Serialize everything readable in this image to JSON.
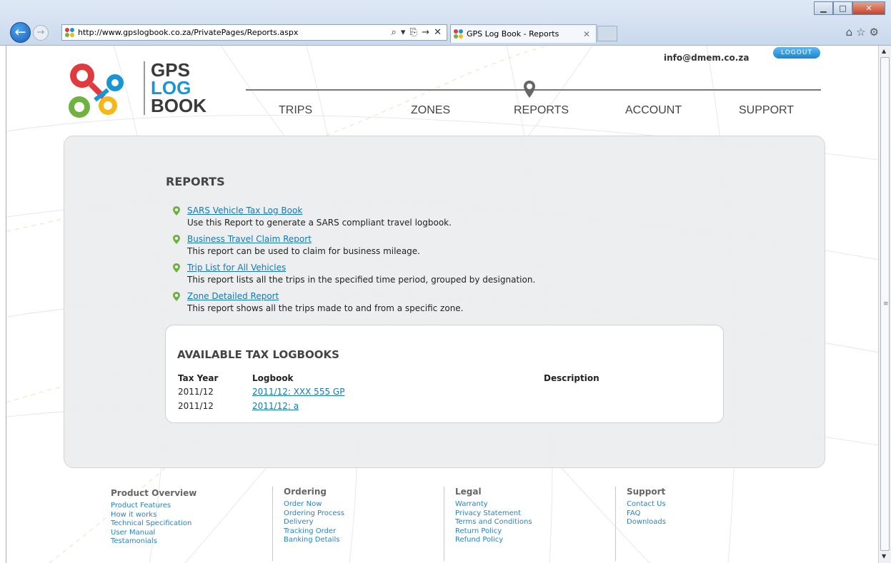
{
  "browser": {
    "url": "http://www.gpslogbook.co.za/PrivatePages/Reports.aspx",
    "address_tools": "⌕ ▾ ⎘ → ✕",
    "tab_title": "GPS Log Book - Reports",
    "tab_close": "✕",
    "back": "←",
    "forward": "→",
    "window_buttons": {
      "minimize": "▁",
      "maximize": "□",
      "close": "✕"
    },
    "toolbar_icons": "⌂☆⚙"
  },
  "header": {
    "logo": {
      "line1": "GPS",
      "line2": "LOG",
      "line3": "BOOK"
    },
    "user_email": "info@dmem.co.za",
    "logout_label": "LOGOUT",
    "nav": [
      {
        "label": "TRIPS"
      },
      {
        "label": "ZONES"
      },
      {
        "label": "REPORTS",
        "active": true
      },
      {
        "label": "ACCOUNT"
      },
      {
        "label": "SUPPORT"
      }
    ]
  },
  "reports": {
    "title": "REPORTS",
    "items": [
      {
        "link": "SARS Vehicle Tax Log Book",
        "desc": "Use this Report to generate a SARS compliant travel logbook."
      },
      {
        "link": "Business Travel Claim Report",
        "desc": "This report can be used to claim for business mileage."
      },
      {
        "link": "Trip List for All Vehicles",
        "desc": "This report lists all the trips in the specified time period, grouped by designation."
      },
      {
        "link": "Zone Detailed Report",
        "desc": "This report shows all the trips made to and from a specific zone."
      }
    ]
  },
  "tax_logbooks": {
    "title": "AVAILABLE TAX LOGBOOKS",
    "columns": [
      "Tax Year",
      "Logbook",
      "Description"
    ],
    "rows": [
      {
        "tax_year": "2011/12",
        "logbook": "2011/12: XXX 555 GP",
        "description": ""
      },
      {
        "tax_year": "2011/12",
        "logbook": "2011/12: a",
        "description": ""
      }
    ]
  },
  "footer": [
    {
      "title": "Product Overview",
      "links": [
        "Product Features",
        "How it works",
        "Technical Specification",
        "User Manual",
        "Testamonials"
      ]
    },
    {
      "title": "Ordering",
      "links": [
        "Order Now",
        "Ordering Process",
        "Delivery",
        "Tracking Order",
        "Banking Details"
      ]
    },
    {
      "title": "Legal",
      "links": [
        "Warranty",
        "Privacy Statement",
        "Terms and Conditions",
        "Return Policy",
        "Refund Policy"
      ]
    },
    {
      "title": "Support",
      "links": [
        "Contact Us",
        "FAQ",
        "Downloads"
      ]
    }
  ],
  "colors": {
    "accent_blue": "#1a95d3",
    "link_blue": "#1579b5",
    "logo_red": "#e03a3e",
    "logo_green": "#6fb23f",
    "logo_yellow": "#f6b719"
  }
}
